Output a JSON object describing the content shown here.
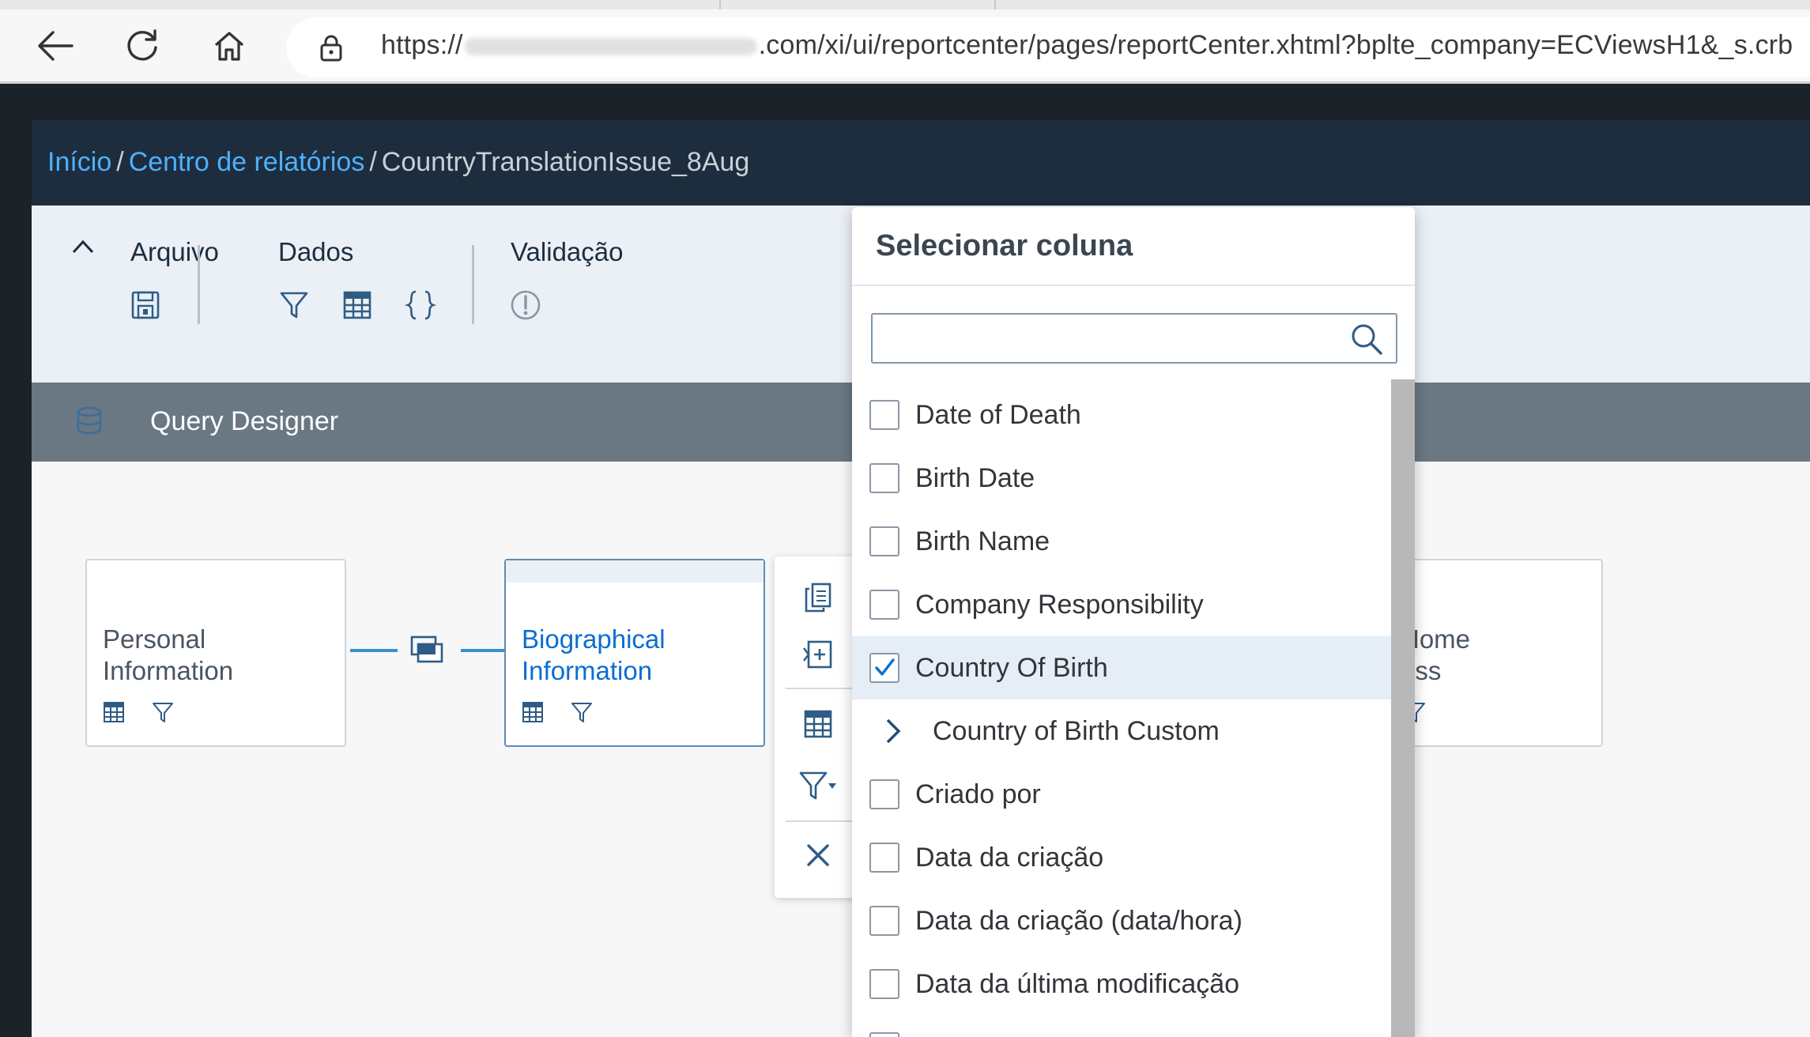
{
  "browser": {
    "url_prefix": "https://",
    "url_suffix": ".com/xi/ui/reportcenter/pages/reportCenter.xhtml?bplte_company=ECViewsH1&_s.crb"
  },
  "breadcrumb": {
    "home": "Início",
    "separator": "/",
    "report_center": "Centro de relatórios",
    "current": "CountryTranslationIssue_8Aug"
  },
  "toolbar": {
    "file_group": "Arquivo",
    "data_group": "Dados",
    "validation_group": "Validação"
  },
  "query_designer": {
    "title": "Query Designer"
  },
  "nodes": [
    {
      "title_line1": "Personal",
      "title_line2": "Information"
    },
    {
      "title_line1": "Biographical",
      "title_line2": "Information"
    },
    {
      "title_line1": "Home",
      "title_line2": "ess"
    }
  ],
  "column_picker": {
    "title": "Selecionar coluna",
    "search_value": "",
    "items": [
      {
        "label": "Date of Death",
        "checked": false
      },
      {
        "label": "Birth Date",
        "checked": false
      },
      {
        "label": "Birth Name",
        "checked": false
      },
      {
        "label": "Company Responsibility",
        "checked": false
      },
      {
        "label": "Country Of Birth",
        "checked": true
      },
      {
        "label": "Country of Birth Custom",
        "expandable": true
      },
      {
        "label": "Criado por",
        "checked": false
      },
      {
        "label": "Data da criação",
        "checked": false
      },
      {
        "label": "Data da criação (data/hora)",
        "checked": false
      },
      {
        "label": "Data da última modificação",
        "checked": false
      }
    ]
  },
  "colors": {
    "shell": "#1d2d3e",
    "link": "#4db1ff",
    "accent": "#0a6ed1",
    "selected_row": "#e5eef7"
  }
}
